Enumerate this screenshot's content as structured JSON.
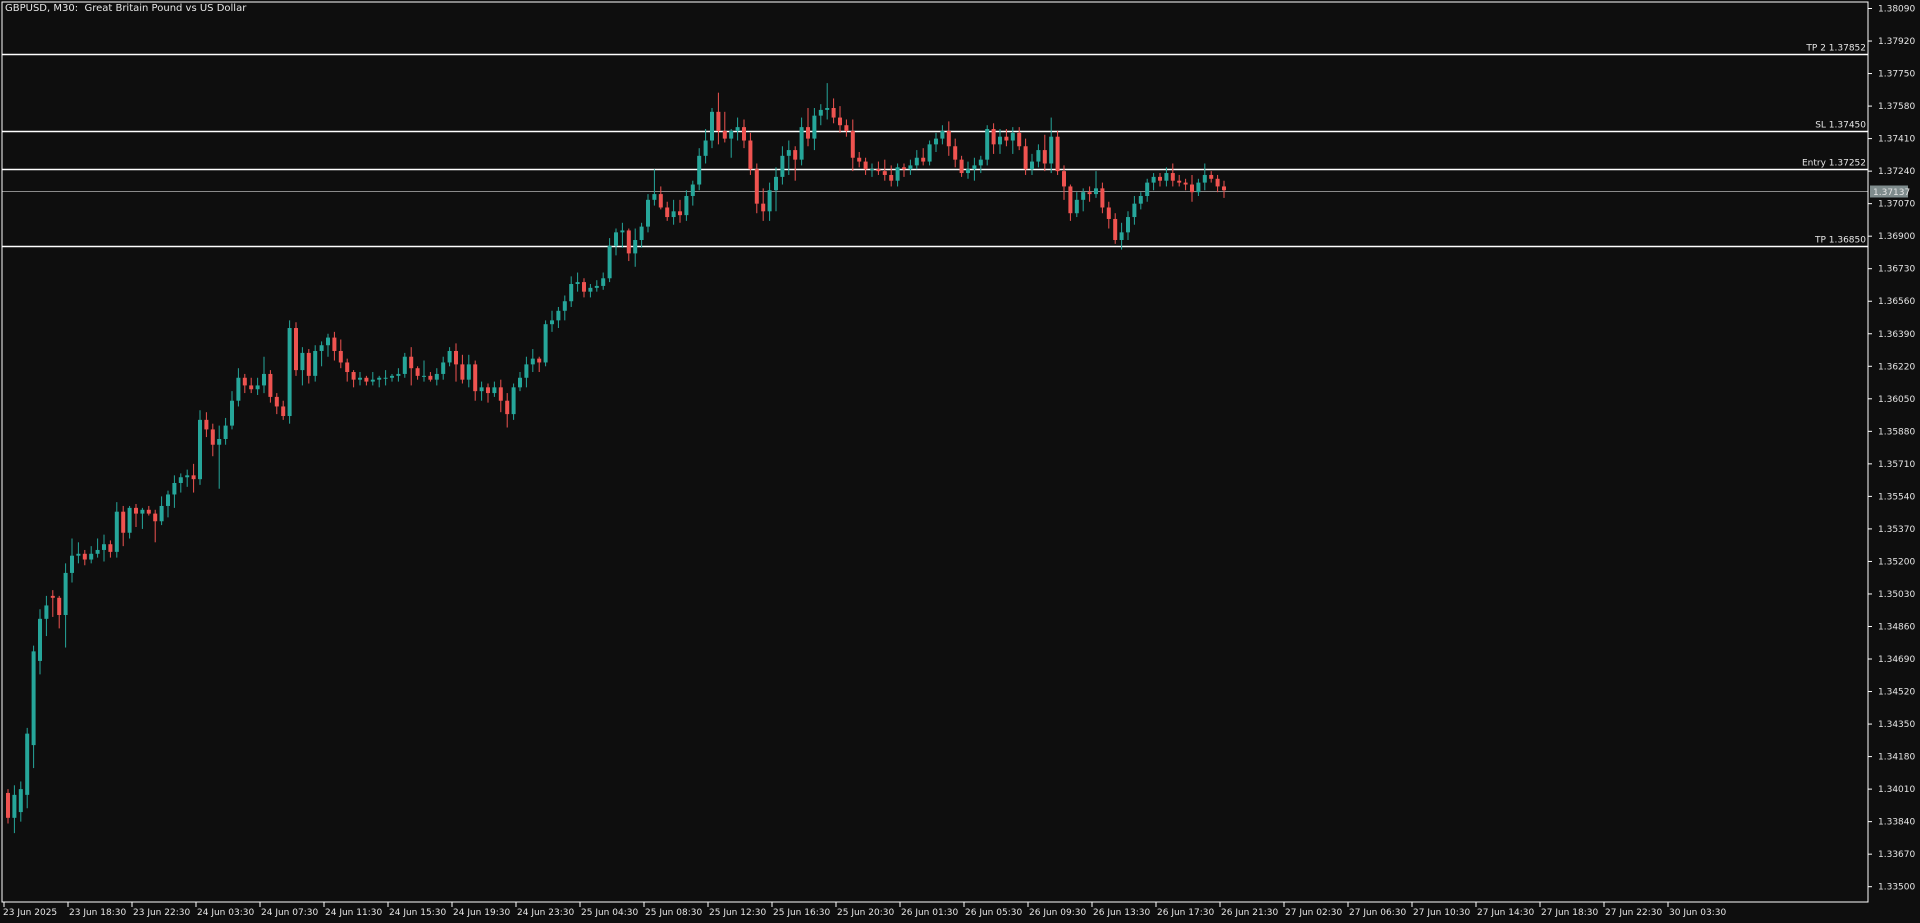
{
  "window": {
    "title": "GBPUSD, M30:  Great Britain Pound vs US Dollar"
  },
  "colors": {
    "background": "#0e0e0e",
    "bull": "#26a69a",
    "bear": "#ef5350",
    "axis": "#ffffff",
    "text": "#e6e6e6",
    "price_tag_bg": "#7f8c8d"
  },
  "chart_data": {
    "type": "candlestick",
    "symbol": "GBPUSD",
    "timeframe": "M30",
    "ylim": [
      1.3342,
      1.38124
    ],
    "price_ticks": [
      "1.38090",
      "1.37920",
      "1.37750",
      "1.37580",
      "1.37410",
      "1.37240",
      "1.37070",
      "1.36900",
      "1.36730",
      "1.36560",
      "1.36390",
      "1.36220",
      "1.36050",
      "1.35880",
      "1.35710",
      "1.35540",
      "1.35370",
      "1.35200",
      "1.35030",
      "1.34860",
      "1.34690",
      "1.34520",
      "1.34350",
      "1.34180",
      "1.34010",
      "1.33840",
      "1.33670",
      "1.33500"
    ],
    "time_labels": [
      "23 Jun 2025",
      "23 Jun 18:30",
      "23 Jun 22:30",
      "24 Jun 03:30",
      "24 Jun 07:30",
      "24 Jun 11:30",
      "24 Jun 15:30",
      "24 Jun 19:30",
      "24 Jun 23:30",
      "25 Jun 04:30",
      "25 Jun 08:30",
      "25 Jun 12:30",
      "25 Jun 16:30",
      "25 Jun 20:30",
      "26 Jun 01:30",
      "26 Jun 05:30",
      "26 Jun 09:30",
      "26 Jun 13:30",
      "26 Jun 17:30",
      "26 Jun 21:30",
      "27 Jun 02:30",
      "27 Jun 06:30",
      "27 Jun 10:30",
      "27 Jun 14:30",
      "27 Jun 18:30",
      "27 Jun 22:30",
      "30 Jun 03:30"
    ],
    "levels": [
      {
        "label": "TP 2 1.37852",
        "price": 1.37852
      },
      {
        "label": "SL 1.37450",
        "price": 1.3745
      },
      {
        "label": "Entry 1.37252",
        "price": 1.37252
      },
      {
        "label": "TP 1.36850",
        "price": 1.3685
      }
    ],
    "current_price": {
      "label": "1.37137",
      "price": 1.37137
    },
    "candles": [
      [
        1.3399,
        1.3401,
        1.3383,
        1.3386
      ],
      [
        1.3386,
        1.3403,
        1.3378,
        1.3398
      ],
      [
        1.3389,
        1.3405,
        1.3384,
        1.3401
      ],
      [
        1.3398,
        1.3433,
        1.3391,
        1.343
      ],
      [
        1.3424,
        1.3476,
        1.3412,
        1.3473
      ],
      [
        1.3468,
        1.3495,
        1.3461,
        1.349
      ],
      [
        1.349,
        1.3502,
        1.3481,
        1.3497
      ],
      [
        1.3502,
        1.3505,
        1.3491,
        1.3501
      ],
      [
        1.3501,
        1.3502,
        1.3485,
        1.3492
      ],
      [
        1.3492,
        1.3519,
        1.3475,
        1.3514
      ],
      [
        1.3514,
        1.3532,
        1.3509,
        1.3523
      ],
      [
        1.3523,
        1.353,
        1.3519,
        1.3524
      ],
      [
        1.3524,
        1.3526,
        1.3518,
        1.3521
      ],
      [
        1.3521,
        1.3528,
        1.3519,
        1.3524
      ],
      [
        1.3524,
        1.3532,
        1.3522,
        1.3526
      ],
      [
        1.3526,
        1.3534,
        1.352,
        1.3529
      ],
      [
        1.3529,
        1.3531,
        1.3522,
        1.3525
      ],
      [
        1.3525,
        1.3551,
        1.3522,
        1.3546
      ],
      [
        1.3546,
        1.3549,
        1.3528,
        1.3535
      ],
      [
        1.3535,
        1.3549,
        1.3532,
        1.3548
      ],
      [
        1.3548,
        1.355,
        1.3538,
        1.3545
      ],
      [
        1.3545,
        1.3548,
        1.3537,
        1.3547
      ],
      [
        1.3547,
        1.3549,
        1.3544,
        1.3545
      ],
      [
        1.3545,
        1.3547,
        1.353,
        1.3541
      ],
      [
        1.3541,
        1.3554,
        1.3539,
        1.3549
      ],
      [
        1.3549,
        1.3557,
        1.3543,
        1.3555
      ],
      [
        1.3555,
        1.3565,
        1.3548,
        1.3561
      ],
      [
        1.3561,
        1.3566,
        1.3556,
        1.3564
      ],
      [
        1.3564,
        1.3568,
        1.3559,
        1.3565
      ],
      [
        1.3565,
        1.3571,
        1.3556,
        1.3563
      ],
      [
        1.3563,
        1.3599,
        1.356,
        1.3594
      ],
      [
        1.3594,
        1.3598,
        1.3585,
        1.3589
      ],
      [
        1.3589,
        1.3592,
        1.3575,
        1.3581
      ],
      [
        1.3581,
        1.3591,
        1.3558,
        1.3584
      ],
      [
        1.3584,
        1.3595,
        1.3581,
        1.3591
      ],
      [
        1.3591,
        1.3609,
        1.3589,
        1.3604
      ],
      [
        1.3604,
        1.3621,
        1.3601,
        1.3616
      ],
      [
        1.3616,
        1.3618,
        1.3608,
        1.3612
      ],
      [
        1.3612,
        1.3616,
        1.3608,
        1.361
      ],
      [
        1.361,
        1.3616,
        1.3607,
        1.3612
      ],
      [
        1.3612,
        1.3627,
        1.3608,
        1.3618
      ],
      [
        1.3618,
        1.362,
        1.3603,
        1.3606
      ],
      [
        1.3606,
        1.3608,
        1.3597,
        1.3601
      ],
      [
        1.3601,
        1.3604,
        1.3594,
        1.3596
      ],
      [
        1.3596,
        1.3646,
        1.3592,
        1.3642
      ],
      [
        1.3642,
        1.3645,
        1.3617,
        1.362
      ],
      [
        1.362,
        1.3632,
        1.3612,
        1.3629
      ],
      [
        1.3629,
        1.3631,
        1.3613,
        1.3617
      ],
      [
        1.3617,
        1.3633,
        1.3614,
        1.363
      ],
      [
        1.363,
        1.3635,
        1.3622,
        1.3633
      ],
      [
        1.3633,
        1.3639,
        1.3627,
        1.3637
      ],
      [
        1.3637,
        1.364,
        1.3625,
        1.363
      ],
      [
        1.363,
        1.3636,
        1.3621,
        1.3624
      ],
      [
        1.3624,
        1.3626,
        1.3614,
        1.3619
      ],
      [
        1.3619,
        1.362,
        1.3611,
        1.3615
      ],
      [
        1.3615,
        1.3619,
        1.3612,
        1.3616
      ],
      [
        1.3616,
        1.3617,
        1.3612,
        1.3614
      ],
      [
        1.3614,
        1.3619,
        1.3612,
        1.3615
      ],
      [
        1.3615,
        1.3617,
        1.3611,
        1.3616
      ],
      [
        1.3616,
        1.362,
        1.3612,
        1.3616
      ],
      [
        1.3616,
        1.3618,
        1.3614,
        1.3617
      ],
      [
        1.3617,
        1.3621,
        1.3614,
        1.3618
      ],
      [
        1.3618,
        1.3629,
        1.3616,
        1.3627
      ],
      [
        1.3627,
        1.3632,
        1.3612,
        1.3621
      ],
      [
        1.3621,
        1.3622,
        1.3615,
        1.3617
      ],
      [
        1.3617,
        1.3625,
        1.3614,
        1.3617
      ],
      [
        1.3617,
        1.3619,
        1.3614,
        1.3615
      ],
      [
        1.3615,
        1.3621,
        1.3612,
        1.3618
      ],
      [
        1.3618,
        1.3627,
        1.3615,
        1.3624
      ],
      [
        1.3624,
        1.3632,
        1.3622,
        1.363
      ],
      [
        1.363,
        1.3634,
        1.3614,
        1.3623
      ],
      [
        1.3623,
        1.3628,
        1.3613,
        1.3615
      ],
      [
        1.3615,
        1.3628,
        1.3611,
        1.3623
      ],
      [
        1.3623,
        1.3625,
        1.3604,
        1.3609
      ],
      [
        1.3609,
        1.3614,
        1.3604,
        1.3611
      ],
      [
        1.3611,
        1.3613,
        1.3603,
        1.3608
      ],
      [
        1.3608,
        1.3614,
        1.3606,
        1.3611
      ],
      [
        1.3611,
        1.3615,
        1.3598,
        1.3604
      ],
      [
        1.3604,
        1.3608,
        1.359,
        1.3597
      ],
      [
        1.3597,
        1.3613,
        1.3594,
        1.3611
      ],
      [
        1.3611,
        1.3619,
        1.3609,
        1.3616
      ],
      [
        1.3616,
        1.3627,
        1.3611,
        1.3623
      ],
      [
        1.3623,
        1.3631,
        1.3619,
        1.3626
      ],
      [
        1.3626,
        1.3627,
        1.3619,
        1.3624
      ],
      [
        1.3624,
        1.3646,
        1.3622,
        1.3644
      ],
      [
        1.3644,
        1.3651,
        1.364,
        1.3646
      ],
      [
        1.3646,
        1.3653,
        1.3642,
        1.3651
      ],
      [
        1.3651,
        1.3659,
        1.3646,
        1.3656
      ],
      [
        1.3656,
        1.3669,
        1.3653,
        1.3665
      ],
      [
        1.3665,
        1.3671,
        1.3661,
        1.3666
      ],
      [
        1.3666,
        1.3668,
        1.3658,
        1.3661
      ],
      [
        1.3661,
        1.3665,
        1.3658,
        1.3663
      ],
      [
        1.3663,
        1.3667,
        1.3661,
        1.3664
      ],
      [
        1.3664,
        1.3671,
        1.3662,
        1.3668
      ],
      [
        1.3668,
        1.3689,
        1.3666,
        1.3685
      ],
      [
        1.3685,
        1.3694,
        1.368,
        1.3692
      ],
      [
        1.3692,
        1.3697,
        1.3684,
        1.3693
      ],
      [
        1.3693,
        1.3694,
        1.3677,
        1.3681
      ],
      [
        1.3681,
        1.3694,
        1.3674,
        1.3688
      ],
      [
        1.3688,
        1.3697,
        1.3684,
        1.3695
      ],
      [
        1.3695,
        1.3712,
        1.3692,
        1.3709
      ],
      [
        1.3709,
        1.3725,
        1.3706,
        1.3712
      ],
      [
        1.3712,
        1.3716,
        1.3704,
        1.3705
      ],
      [
        1.3705,
        1.3708,
        1.3698,
        1.37
      ],
      [
        1.37,
        1.3709,
        1.3696,
        1.3703
      ],
      [
        1.3703,
        1.3709,
        1.3697,
        1.3701
      ],
      [
        1.3701,
        1.3714,
        1.3698,
        1.3711
      ],
      [
        1.3711,
        1.3719,
        1.3706,
        1.3717
      ],
      [
        1.3717,
        1.3736,
        1.3714,
        1.3732
      ],
      [
        1.3732,
        1.3746,
        1.3728,
        1.374
      ],
      [
        1.374,
        1.3757,
        1.3736,
        1.3755
      ],
      [
        1.3755,
        1.3765,
        1.3738,
        1.3745
      ],
      [
        1.3745,
        1.3755,
        1.3739,
        1.3741
      ],
      [
        1.3741,
        1.3746,
        1.3731,
        1.3745
      ],
      [
        1.3745,
        1.3752,
        1.374,
        1.3747
      ],
      [
        1.3747,
        1.3751,
        1.3736,
        1.374
      ],
      [
        1.374,
        1.3744,
        1.3722,
        1.3725
      ],
      [
        1.3725,
        1.3728,
        1.3702,
        1.3707
      ],
      [
        1.3707,
        1.3715,
        1.3698,
        1.3703
      ],
      [
        1.3703,
        1.3718,
        1.3698,
        1.3714
      ],
      [
        1.3714,
        1.3726,
        1.3703,
        1.3721
      ],
      [
        1.3721,
        1.3737,
        1.3717,
        1.3732
      ],
      [
        1.3732,
        1.374,
        1.3722,
        1.3735
      ],
      [
        1.3735,
        1.3737,
        1.3719,
        1.373
      ],
      [
        1.373,
        1.3752,
        1.3727,
        1.3747
      ],
      [
        1.3747,
        1.3757,
        1.3737,
        1.3741
      ],
      [
        1.3741,
        1.3757,
        1.3735,
        1.3753
      ],
      [
        1.3753,
        1.3759,
        1.3748,
        1.3756
      ],
      [
        1.3756,
        1.377,
        1.3751,
        1.3757
      ],
      [
        1.3757,
        1.3762,
        1.3749,
        1.3752
      ],
      [
        1.3752,
        1.3758,
        1.3744,
        1.3748
      ],
      [
        1.3748,
        1.3751,
        1.3742,
        1.3745
      ],
      [
        1.3745,
        1.3751,
        1.3724,
        1.3731
      ],
      [
        1.3731,
        1.3734,
        1.3726,
        1.3729
      ],
      [
        1.3729,
        1.3731,
        1.3722,
        1.3725
      ],
      [
        1.3725,
        1.3728,
        1.3721,
        1.3725
      ],
      [
        1.3725,
        1.3729,
        1.3722,
        1.3724
      ],
      [
        1.3724,
        1.373,
        1.3719,
        1.3722
      ],
      [
        1.3722,
        1.3727,
        1.3716,
        1.3719
      ],
      [
        1.3719,
        1.3728,
        1.3716,
        1.3726
      ],
      [
        1.3726,
        1.3728,
        1.3721,
        1.3725
      ],
      [
        1.3725,
        1.373,
        1.3722,
        1.3727
      ],
      [
        1.3727,
        1.3735,
        1.3725,
        1.3731
      ],
      [
        1.3731,
        1.3736,
        1.3727,
        1.3729
      ],
      [
        1.3729,
        1.374,
        1.3727,
        1.3738
      ],
      [
        1.3738,
        1.3744,
        1.3734,
        1.3741
      ],
      [
        1.3741,
        1.3748,
        1.3738,
        1.3745
      ],
      [
        1.3745,
        1.375,
        1.3732,
        1.3737
      ],
      [
        1.3737,
        1.3741,
        1.3726,
        1.373
      ],
      [
        1.373,
        1.3732,
        1.3721,
        1.3723
      ],
      [
        1.3723,
        1.3729,
        1.372,
        1.3725
      ],
      [
        1.3725,
        1.3731,
        1.3719,
        1.3727
      ],
      [
        1.3727,
        1.3732,
        1.3723,
        1.373
      ],
      [
        1.373,
        1.3748,
        1.3727,
        1.3746
      ],
      [
        1.3746,
        1.3749,
        1.3733,
        1.3738
      ],
      [
        1.3738,
        1.3746,
        1.3733,
        1.3742
      ],
      [
        1.3742,
        1.3746,
        1.3737,
        1.374
      ],
      [
        1.374,
        1.3747,
        1.3733,
        1.3744
      ],
      [
        1.3744,
        1.3747,
        1.3735,
        1.3737
      ],
      [
        1.3737,
        1.3741,
        1.3722,
        1.3725
      ],
      [
        1.3725,
        1.3733,
        1.3722,
        1.3729
      ],
      [
        1.3729,
        1.3738,
        1.3726,
        1.3735
      ],
      [
        1.3735,
        1.3743,
        1.3724,
        1.3728
      ],
      [
        1.3728,
        1.3752,
        1.3723,
        1.3742
      ],
      [
        1.3742,
        1.3745,
        1.3722,
        1.3724
      ],
      [
        1.3724,
        1.3727,
        1.3709,
        1.3716
      ],
      [
        1.3716,
        1.3717,
        1.3698,
        1.3702
      ],
      [
        1.3702,
        1.3713,
        1.37,
        1.3709
      ],
      [
        1.3709,
        1.3715,
        1.3703,
        1.3713
      ],
      [
        1.3713,
        1.3716,
        1.3708,
        1.3712
      ],
      [
        1.3712,
        1.3724,
        1.371,
        1.3715
      ],
      [
        1.3715,
        1.3718,
        1.3702,
        1.3705
      ],
      [
        1.3705,
        1.3708,
        1.3694,
        1.3699
      ],
      [
        1.3699,
        1.3702,
        1.3686,
        1.3688
      ],
      [
        1.3688,
        1.3697,
        1.3683,
        1.3692
      ],
      [
        1.3692,
        1.3703,
        1.3688,
        1.37
      ],
      [
        1.37,
        1.3711,
        1.3696,
        1.3707
      ],
      [
        1.3707,
        1.3713,
        1.3704,
        1.3711
      ],
      [
        1.3711,
        1.372,
        1.3708,
        1.3718
      ],
      [
        1.3718,
        1.3723,
        1.3714,
        1.3721
      ],
      [
        1.3721,
        1.3723,
        1.3716,
        1.3719
      ],
      [
        1.3719,
        1.3726,
        1.3716,
        1.3723
      ],
      [
        1.3723,
        1.3728,
        1.3716,
        1.3719
      ],
      [
        1.3719,
        1.3722,
        1.3716,
        1.3718
      ],
      [
        1.3718,
        1.372,
        1.3714,
        1.3717
      ],
      [
        1.3717,
        1.3722,
        1.3708,
        1.3713
      ],
      [
        1.3713,
        1.372,
        1.3711,
        1.3718
      ],
      [
        1.3718,
        1.3728,
        1.3714,
        1.3722
      ],
      [
        1.3722,
        1.3724,
        1.3718,
        1.372
      ],
      [
        1.372,
        1.3722,
        1.3713,
        1.3716
      ],
      [
        1.3716,
        1.3719,
        1.371,
        1.3714
      ]
    ]
  }
}
